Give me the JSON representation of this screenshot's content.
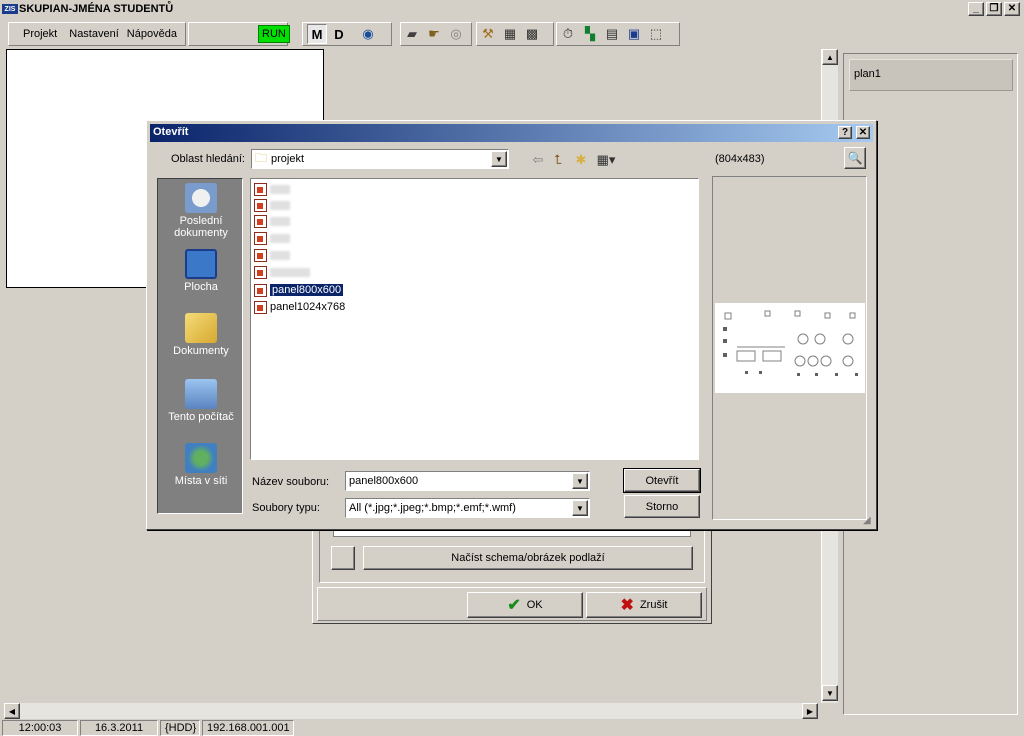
{
  "window": {
    "title": "SKUPIAN-JMÉNA STUDENTŮ",
    "app_icon_label": "ZIS"
  },
  "menu": {
    "project": "Projekt",
    "settings": "Nastavení",
    "help": "Nápověda"
  },
  "toolbar": {
    "run_label": "RUN",
    "m_label": "M",
    "d_label": "D"
  },
  "plan_list": {
    "items": [
      "plan1"
    ]
  },
  "statusbar": {
    "time": "12:00:03",
    "date": "16.3.2011",
    "drive": "{HDD}",
    "ip": "192.168.001.001"
  },
  "bg_dialog": {
    "load_button": "Načíst schema/obrázek podlaží",
    "ok_button": "OK",
    "cancel_button": "Zrušit"
  },
  "open_dialog": {
    "title": "Otevřít",
    "look_in_label": "Oblast hledání:",
    "look_in_value": "projekt",
    "preview_size": "(804x483)",
    "places": [
      "Poslední dokumenty",
      "Plocha",
      "Dokumenty",
      "Tento počítač",
      "Místa v síti"
    ],
    "files": [
      "panel800x600",
      "panel1024x768"
    ],
    "filename_label": "Název souboru:",
    "filename_value": "panel800x600",
    "filetype_label": "Soubory typu:",
    "filetype_value": "All (*.jpg;*.jpeg;*.bmp;*.emf;*.wmf)",
    "open_button": "Otevřít",
    "cancel_button": "Storno",
    "help_button": "?",
    "close_button": "✕"
  },
  "colors": {
    "titlebar_start": "#0a246a",
    "titlebar_end": "#a6caf0",
    "run_green": "#00e000",
    "selection": "#0a246a"
  }
}
